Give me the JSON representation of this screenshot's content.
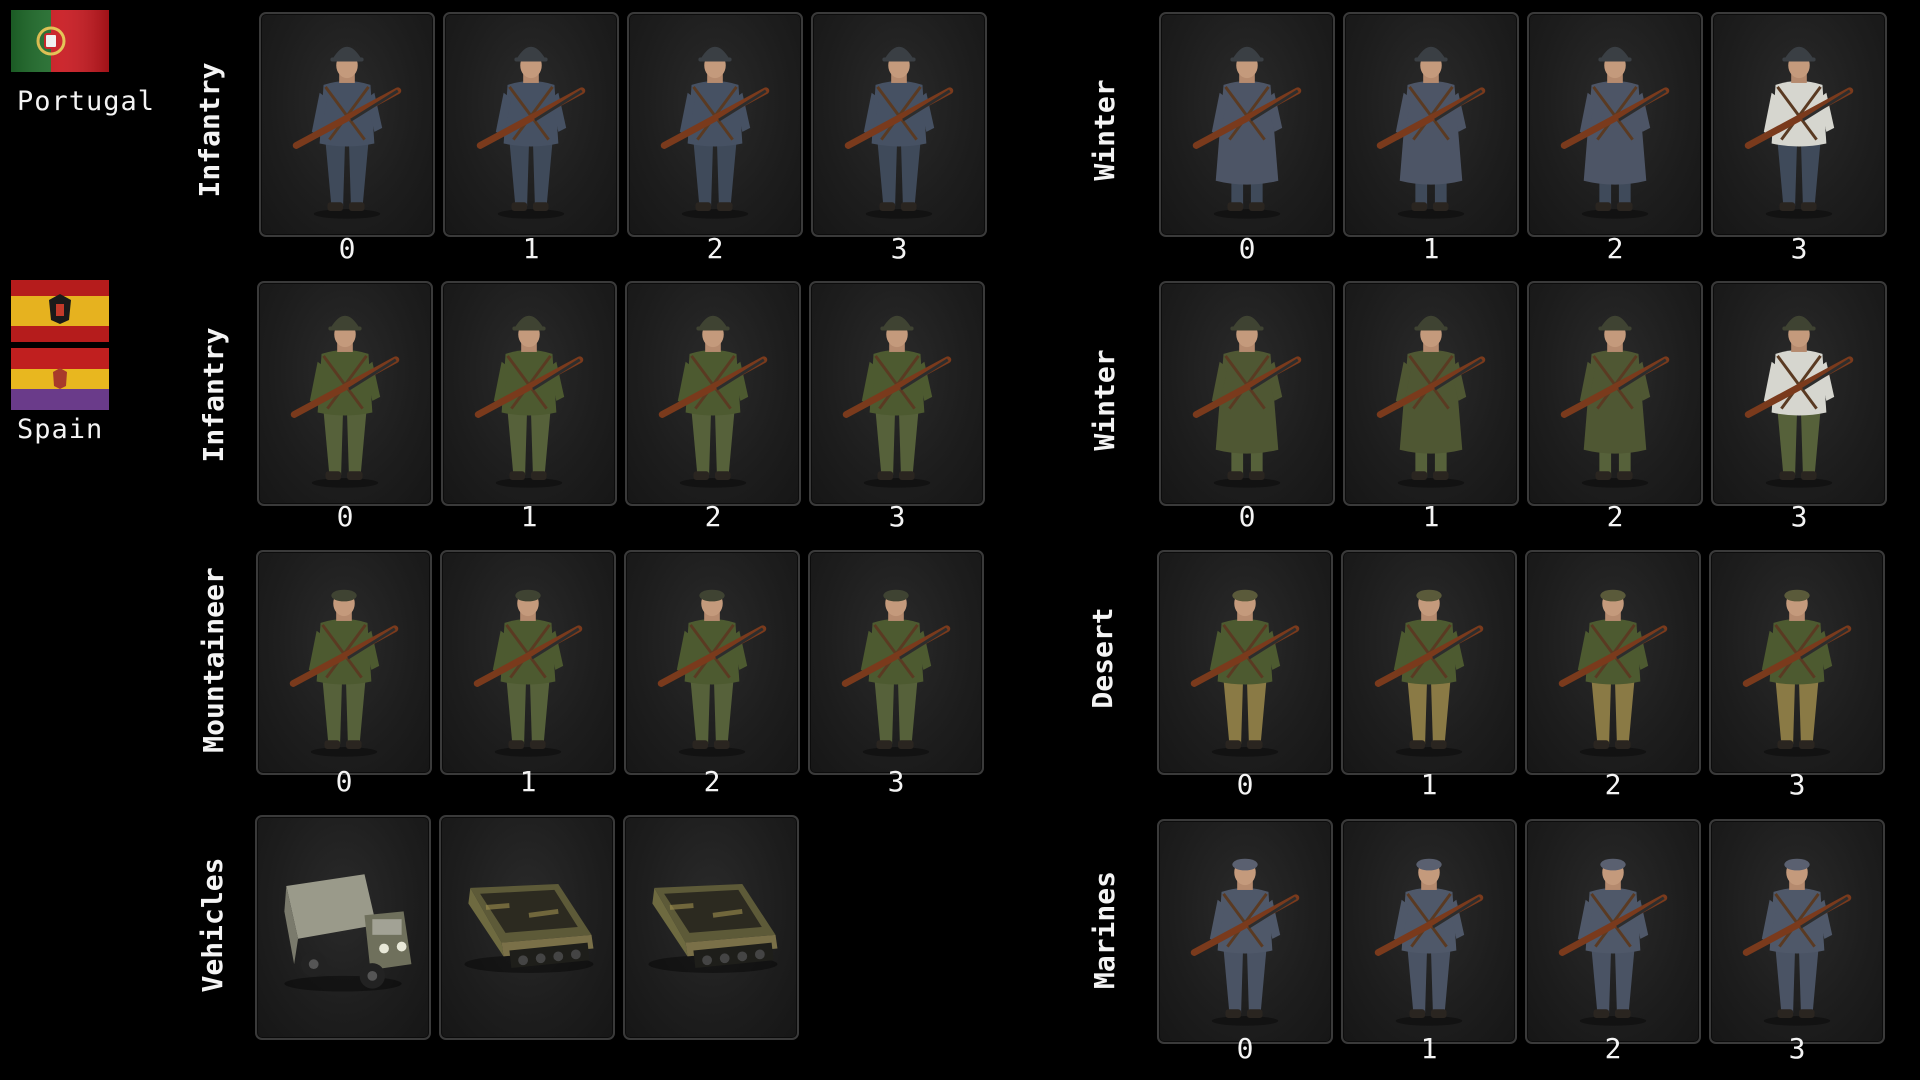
{
  "countries": [
    {
      "name": "Portugal",
      "flag": "portugal-flag-icon"
    },
    {
      "name": "Spain",
      "flags": [
        "spanish-nationalist-flag-icon",
        "spanish-republic-flag-icon"
      ]
    }
  ],
  "colors": {
    "background": "#000000",
    "card_border": "#3a3a3a",
    "portugal_uniform": "#4a5566",
    "spain_uniform": "#4f5a32",
    "desert_trousers": "#8a7a45",
    "winter_coat": "#d8d8d2",
    "marines_uniform": "#505a6a"
  },
  "groups": [
    {
      "id": "portugal-infantry",
      "label": "Infantry",
      "cards": [
        {
          "number": "0",
          "icon": "portugal-infantry-soldier-icon"
        },
        {
          "number": "1",
          "icon": "portugal-infantry-soldier-icon"
        },
        {
          "number": "2",
          "icon": "portugal-infantry-soldier-icon"
        },
        {
          "number": "3",
          "icon": "portugal-infantry-soldier-icon"
        }
      ]
    },
    {
      "id": "portugal-winter",
      "label": "Winter",
      "cards": [
        {
          "number": "0",
          "icon": "portugal-winter-soldier-icon"
        },
        {
          "number": "1",
          "icon": "portugal-winter-soldier-icon"
        },
        {
          "number": "2",
          "icon": "portugal-winter-soldier-icon"
        },
        {
          "number": "3",
          "icon": "portugal-winter-white-soldier-icon"
        }
      ]
    },
    {
      "id": "spain-infantry",
      "label": "Infantry",
      "cards": [
        {
          "number": "0",
          "icon": "spain-infantry-soldier-icon"
        },
        {
          "number": "1",
          "icon": "spain-infantry-soldier-icon"
        },
        {
          "number": "2",
          "icon": "spain-infantry-soldier-icon"
        },
        {
          "number": "3",
          "icon": "spain-infantry-soldier-icon"
        }
      ]
    },
    {
      "id": "spain-winter",
      "label": "Winter",
      "cards": [
        {
          "number": "0",
          "icon": "spain-winter-soldier-icon"
        },
        {
          "number": "1",
          "icon": "spain-winter-soldier-icon"
        },
        {
          "number": "2",
          "icon": "spain-winter-soldier-icon"
        },
        {
          "number": "3",
          "icon": "spain-winter-white-soldier-icon"
        }
      ]
    },
    {
      "id": "spain-mountaineer",
      "label": "Mountaineer",
      "cards": [
        {
          "number": "0",
          "icon": "spain-mountaineer-soldier-icon"
        },
        {
          "number": "1",
          "icon": "spain-mountaineer-soldier-icon"
        },
        {
          "number": "2",
          "icon": "spain-mountaineer-soldier-icon"
        },
        {
          "number": "3",
          "icon": "spain-mountaineer-soldier-icon"
        }
      ]
    },
    {
      "id": "spain-desert",
      "label": "Desert",
      "cards": [
        {
          "number": "0",
          "icon": "spain-desert-soldier-icon"
        },
        {
          "number": "1",
          "icon": "spain-desert-soldier-icon"
        },
        {
          "number": "2",
          "icon": "spain-desert-soldier-icon"
        },
        {
          "number": "3",
          "icon": "spain-desert-soldier-icon"
        }
      ]
    },
    {
      "id": "spain-vehicles",
      "label": "Vehicles",
      "cards": [
        {
          "icon": "truck-icon"
        },
        {
          "icon": "halftrack-icon"
        },
        {
          "icon": "halftrack-icon"
        }
      ]
    },
    {
      "id": "spain-marines",
      "label": "Marines",
      "cards": [
        {
          "number": "0",
          "icon": "spain-marines-soldier-icon"
        },
        {
          "number": "1",
          "icon": "spain-marines-soldier-icon"
        },
        {
          "number": "2",
          "icon": "spain-marines-soldier-icon"
        },
        {
          "number": "3",
          "icon": "spain-marines-soldier-icon"
        }
      ]
    }
  ]
}
